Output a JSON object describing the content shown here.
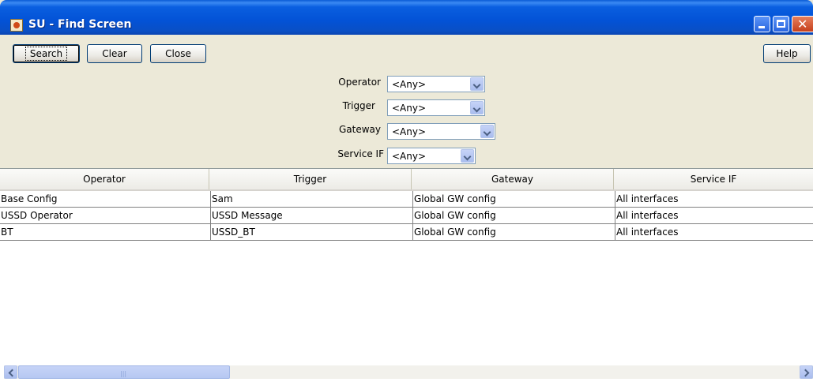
{
  "window": {
    "title": "SU - Find Screen",
    "controls": [
      "minimize-icon",
      "maximize-icon",
      "close-icon"
    ]
  },
  "toolbar": {
    "search_label": "Search",
    "clear_label": "Clear",
    "close_label": "Close",
    "help_label": "Help"
  },
  "filters": [
    {
      "label": "Operator",
      "value": "<Any>"
    },
    {
      "label": "Trigger",
      "value": "<Any>"
    },
    {
      "label": "Gateway",
      "value": "<Any>"
    },
    {
      "label": "Service IF",
      "value": "<Any>"
    }
  ],
  "table": {
    "columns": [
      "Operator",
      "Trigger",
      "Gateway",
      "Service IF"
    ],
    "rows": [
      [
        "Base Config",
        "Sam",
        "Global GW config",
        "All interfaces"
      ],
      [
        "USSD Operator",
        "USSD Message",
        "Global GW config",
        "All interfaces"
      ],
      [
        "BT",
        "USSD_BT",
        "Global GW config",
        "All interfaces"
      ]
    ]
  },
  "scrollbar": {
    "icons": [
      "scroll-left-icon",
      "scroll-right-icon"
    ],
    "grip": "|||"
  }
}
